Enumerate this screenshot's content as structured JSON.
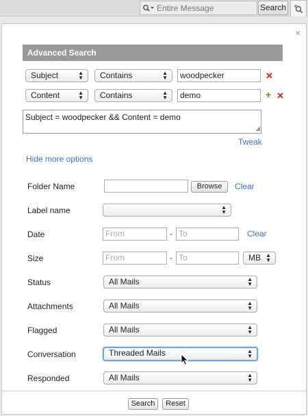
{
  "topbar": {
    "search_placeholder": "Entire Message",
    "search_button": "Search"
  },
  "panel": {
    "close_glyph": "×",
    "title": "Advanced Search"
  },
  "criteria": [
    {
      "field": "Subject",
      "operator": "Contains",
      "value": "woodpecker",
      "remove": "✕"
    },
    {
      "field": "Content",
      "operator": "Contains",
      "value": "demo",
      "add": "+",
      "remove": "✕"
    }
  ],
  "query_text": "Subject = woodpecker && Content = demo",
  "tweak_link": "Tweak",
  "hide_options_link": "Hide more options",
  "options": {
    "folder_name": {
      "label": "Folder Name",
      "value": "",
      "browse": "Browse",
      "clear": "Clear"
    },
    "label_name": {
      "label": "Label name",
      "value": ""
    },
    "date": {
      "label": "Date",
      "from_placeholder": "From",
      "to_placeholder": "To",
      "separator": "-",
      "clear": "Clear"
    },
    "size": {
      "label": "Size",
      "from_placeholder": "From",
      "to_placeholder": "To",
      "separator": "-",
      "unit": "MB"
    },
    "status": {
      "label": "Status",
      "value": "All Mails"
    },
    "attachments": {
      "label": "Attachments",
      "value": "All Mails"
    },
    "flagged": {
      "label": "Flagged",
      "value": "All Mails"
    },
    "conversation": {
      "label": "Conversation",
      "value": "Threaded Mails"
    },
    "responded": {
      "label": "Responded",
      "value": "All Mails"
    }
  },
  "footer": {
    "search_button": "Search",
    "reset_button": "Reset"
  },
  "icons": {
    "search": "magnifier-dropdown-icon",
    "advanced": "advanced-search-icon"
  },
  "colors": {
    "header_bg": "#9a9a9a",
    "link": "#3b6fd3",
    "remove": "#d52121",
    "add": "#4a9a1e",
    "focus_ring": "#6da5e6"
  }
}
